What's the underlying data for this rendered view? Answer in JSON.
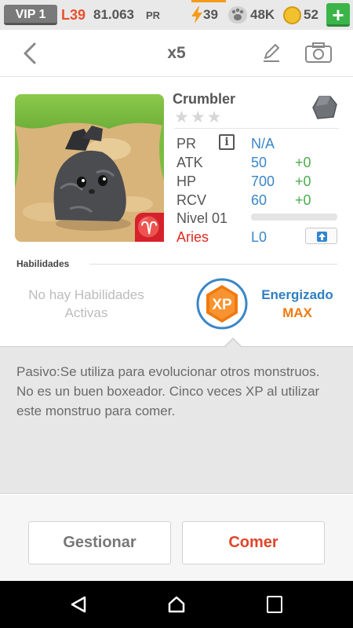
{
  "status_bar": {
    "vip": "VIP 1",
    "level": "L39",
    "pr_value": "81.063",
    "pr_unit": "PR",
    "energy": "39",
    "paws": "48K",
    "coins": "52",
    "plus": "+"
  },
  "nav": {
    "title": "x5"
  },
  "monster": {
    "name": "Crumbler",
    "stars": "★★★",
    "sign_symbol": "♈",
    "stats": {
      "pr_label": "PR",
      "pr_value": "N/A",
      "atk_label": "ATK",
      "atk_value": "50",
      "atk_bonus": "+0",
      "hp_label": "HP",
      "hp_value": "700",
      "hp_bonus": "+0",
      "rcv_label": "RCV",
      "rcv_value": "60",
      "rcv_bonus": "+0",
      "level_label": "Nivel 01",
      "xp_progress": 0,
      "sign_label": "Aries",
      "sign_level": "L0"
    }
  },
  "skills": {
    "header": "Habilidades",
    "none_text": "No hay Habilidades Activas",
    "xp_badge": "XP",
    "energized": "Energizado",
    "max": "MAX"
  },
  "description": "Pasivo:Se utiliza para evolucionar otros monstruos. No es un buen boxeador. Cinco veces XP al utilizar este monstruo para comer.",
  "buttons": {
    "manage": "Gestionar",
    "eat": "Comer"
  },
  "colors": {
    "accent_blue": "#3a86c8",
    "bonus_green": "#4cae4c",
    "eat_red": "#e0452a",
    "xp_orange": "#f07a0f"
  }
}
